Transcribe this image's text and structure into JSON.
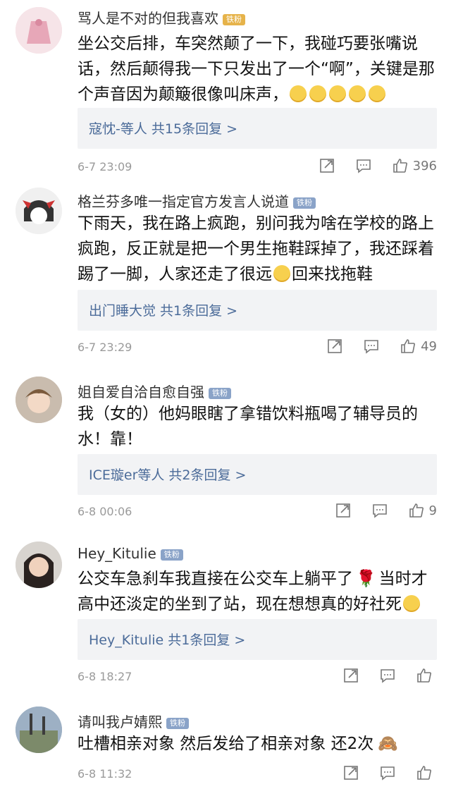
{
  "comments": [
    {
      "username": "骂人是不对的但我喜欢",
      "badge": "铁粉",
      "text": "坐公交后排，车突然颠了一下，我碰巧要张嘴说话，然后颠得我一下只发出了一个“啊”，关键是那个声音因为颠簸很像叫床声，",
      "reply_summary": "寇忱-等人  共15条回复 >",
      "time": "6-7 23:09",
      "likes": "396"
    },
    {
      "username": "格兰芬多唯一指定官方发言人说道",
      "badge": "铁粉",
      "text": "下雨天，我在路上疯跑，别问我为啥在学校的路上疯跑，反正就是把一个男生拖鞋踩掉了，我还踩着踢了一脚，人家还走了很远",
      "text_tail": "回来找拖鞋",
      "reply_summary": "出门睡大觉  共1条回复 >",
      "time": "6-7 23:29",
      "likes": "49"
    },
    {
      "username": "姐自爱自洽自愈自强",
      "badge": "铁粉",
      "text": "我（女的）他妈眼瞎了拿错饮料瓶喝了辅导员的水！靠！",
      "reply_summary": "ICE璇er等人  共2条回复 >",
      "time": "6-8 00:06",
      "likes": "9"
    },
    {
      "username": "Hey_Kitulie",
      "badge": "铁粉",
      "text": "公交车急刹车我直接在公交车上躺平了",
      "text_tail": "当时才高中还淡定的坐到了站，现在想想真的好社死",
      "reply_summary": "Hey_Kitulie  共1条回复 >",
      "time": "6-8 18:27",
      "likes": ""
    },
    {
      "username": "请叫我卢婧熙",
      "badge": "铁粉",
      "text": "吐槽相亲对象 然后发给了相亲对象  还2次",
      "time": "6-8 11:32",
      "likes": ""
    }
  ],
  "icons": [
    "share-icon",
    "comment-icon",
    "like-icon"
  ],
  "colors": {
    "reply_link": "#4b6b99",
    "reply_bg": "#f2f3f5",
    "meta": "#9a9a9a"
  }
}
